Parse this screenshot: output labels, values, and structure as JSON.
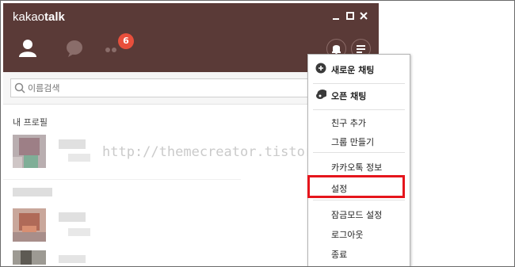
{
  "app": {
    "brand_light": "kakao",
    "brand_bold": "talk",
    "window_controls": [
      "minimize-icon",
      "maximize-icon",
      "close-icon"
    ],
    "tabs": [
      {
        "name": "friends",
        "icon": "person-icon"
      },
      {
        "name": "chats",
        "icon": "chat-bubble-icon"
      },
      {
        "name": "more",
        "icon": "dots-icon",
        "badge": "6"
      }
    ],
    "header_buttons": [
      "bell-icon",
      "menu-icon"
    ]
  },
  "search": {
    "placeholder": "이름검색"
  },
  "friends": {
    "my_profile_label": "내 프로필"
  },
  "menu": {
    "items": [
      {
        "label": "새로운 채팅",
        "bold": true,
        "icon": "new-chat-icon"
      },
      {
        "label": "오픈 채팅",
        "bold": true,
        "icon": "open-chat-icon"
      },
      {
        "label": "친구 추가"
      },
      {
        "label": "그룹 만들기"
      },
      {
        "label": "카카오톡 정보"
      },
      {
        "label": "설정",
        "highlighted": true
      },
      {
        "label": "잠금모드 설정"
      },
      {
        "label": "로그아웃"
      },
      {
        "label": "종료"
      }
    ]
  },
  "watermark": "http://themecreator.tistory.com",
  "colors": {
    "titlebar": "#5a3a37",
    "badge": "#e84f3c",
    "highlight": "#e5151c"
  }
}
